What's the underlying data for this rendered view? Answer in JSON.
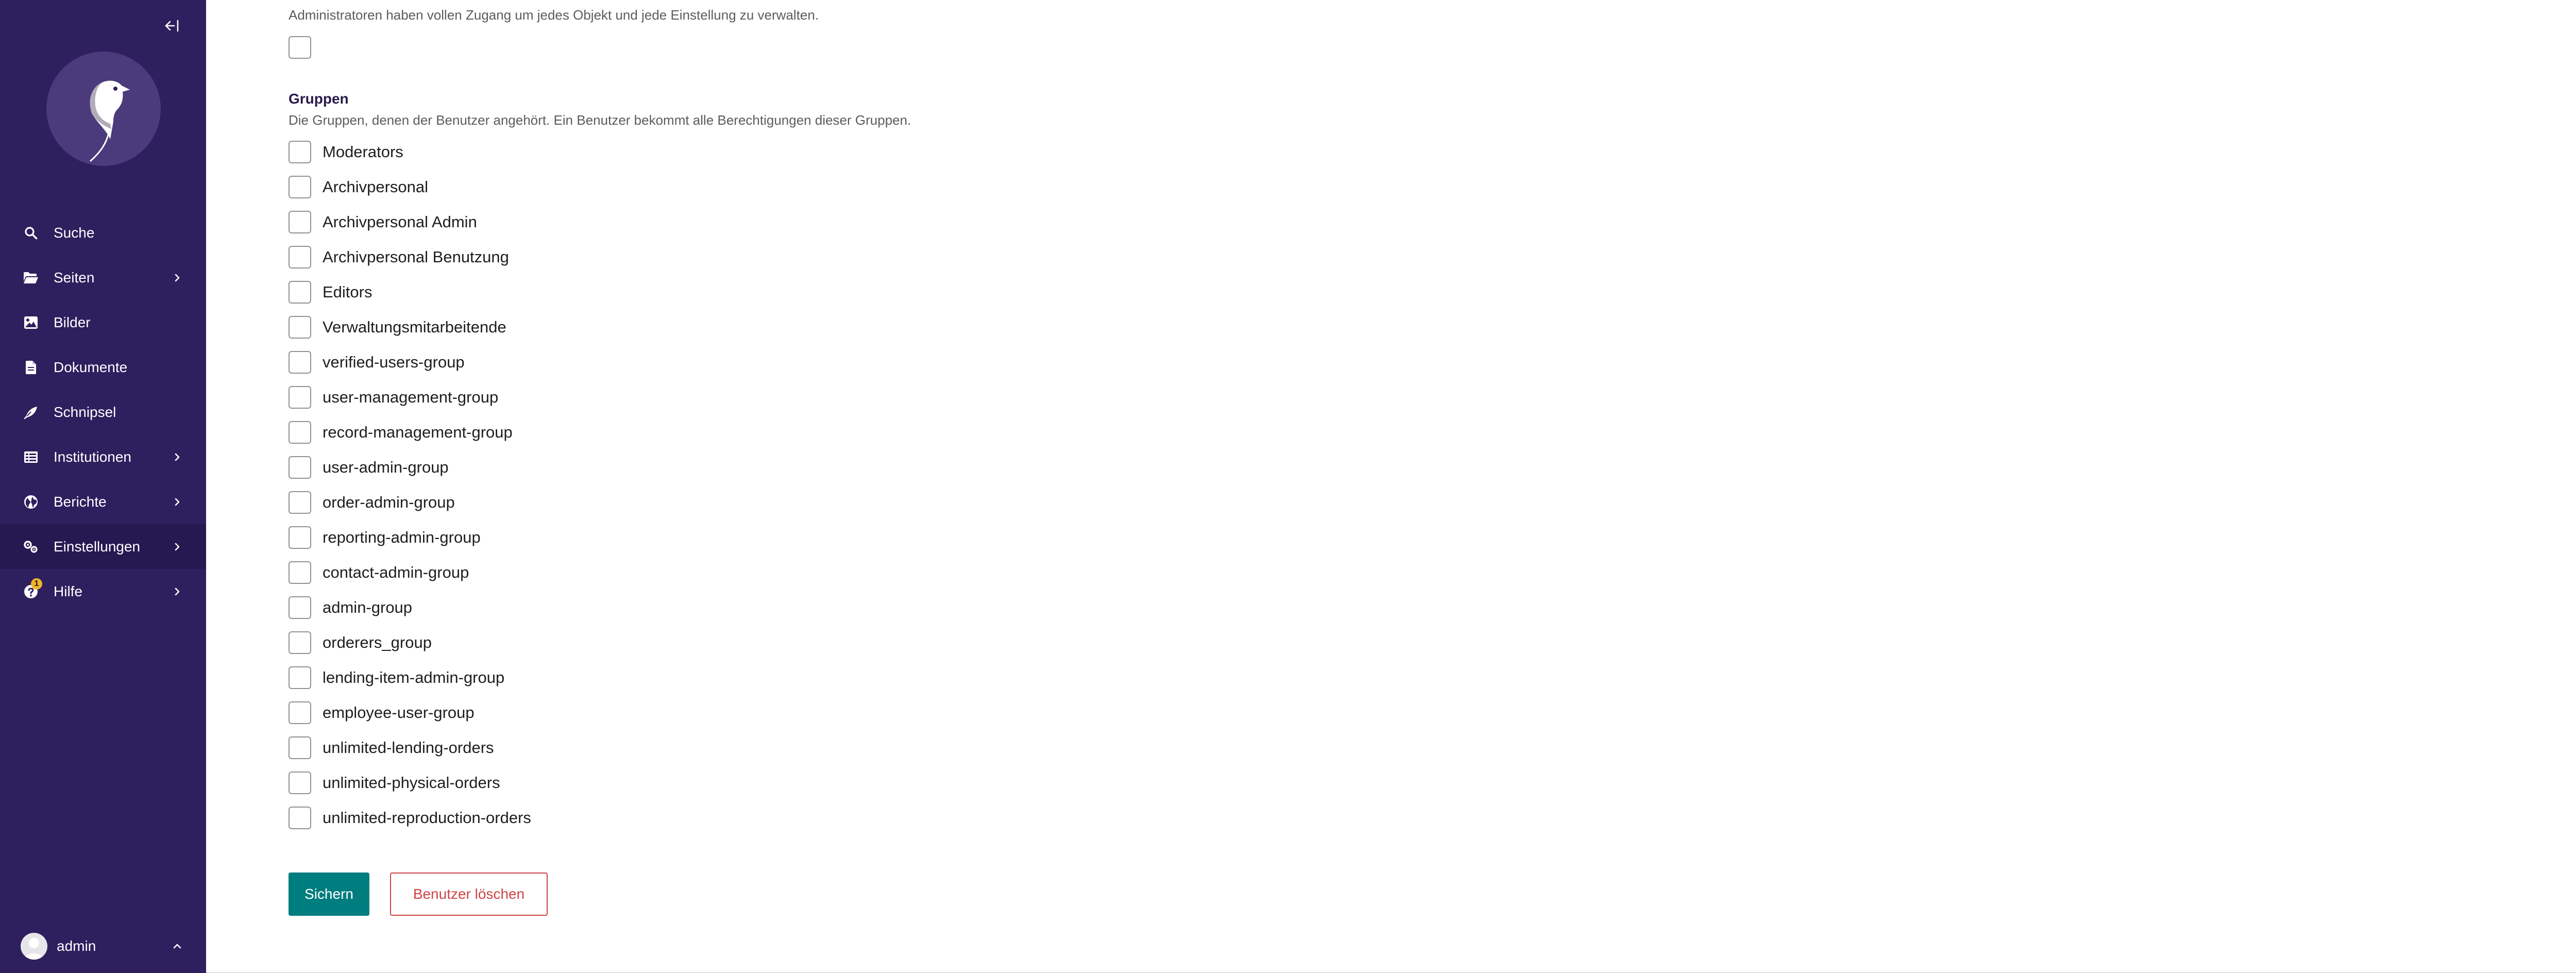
{
  "sidebar": {
    "colors": {
      "background": "#2e1f5e",
      "active": "#261952",
      "badge": "#f0b429"
    },
    "collapse_icon": "collapse-left-icon",
    "logo_icon": "wagtail-bird-logo",
    "items": [
      {
        "label": "Suche",
        "icon": "search-icon",
        "chevron": false
      },
      {
        "label": "Seiten",
        "icon": "folder-open-icon",
        "chevron": true
      },
      {
        "label": "Bilder",
        "icon": "image-icon",
        "chevron": false
      },
      {
        "label": "Dokumente",
        "icon": "document-icon",
        "chevron": false
      },
      {
        "label": "Schnipsel",
        "icon": "snippet-icon",
        "chevron": false
      },
      {
        "label": "Institutionen",
        "icon": "table-list-icon",
        "chevron": true
      },
      {
        "label": "Berichte",
        "icon": "globe-icon",
        "chevron": true
      },
      {
        "label": "Einstellungen",
        "icon": "cogs-icon",
        "chevron": true,
        "active": true
      },
      {
        "label": "Hilfe",
        "icon": "help-icon",
        "chevron": true,
        "badge": "1"
      }
    ],
    "account": {
      "name": "admin",
      "icon": "avatar-default"
    }
  },
  "admin_field": {
    "help": "Administratoren haben vollen Zugang um jedes Objekt und jede Einstellung zu verwalten.",
    "checked": false
  },
  "groups": {
    "label": "Gruppen",
    "help": "Die Gruppen, denen der Benutzer angehört. Ein Benutzer bekommt alle Berechtigungen dieser Gruppen.",
    "items": [
      "Moderators",
      "Archivpersonal",
      "Archivpersonal Admin",
      "Archivpersonal Benutzung",
      "Editors",
      "Verwaltungsmitarbeitende",
      "verified-users-group",
      "user-management-group",
      "record-management-group",
      "user-admin-group",
      "order-admin-group",
      "reporting-admin-group",
      "contact-admin-group",
      "admin-group",
      "orderers_group",
      "lending-item-admin-group",
      "employee-user-group",
      "unlimited-lending-orders",
      "unlimited-physical-orders",
      "unlimited-reproduction-orders"
    ]
  },
  "actions": {
    "save_label": "Sichern",
    "delete_label": "Benutzer löschen",
    "colors": {
      "save": "#007d7e",
      "delete": "#cd4444"
    }
  }
}
